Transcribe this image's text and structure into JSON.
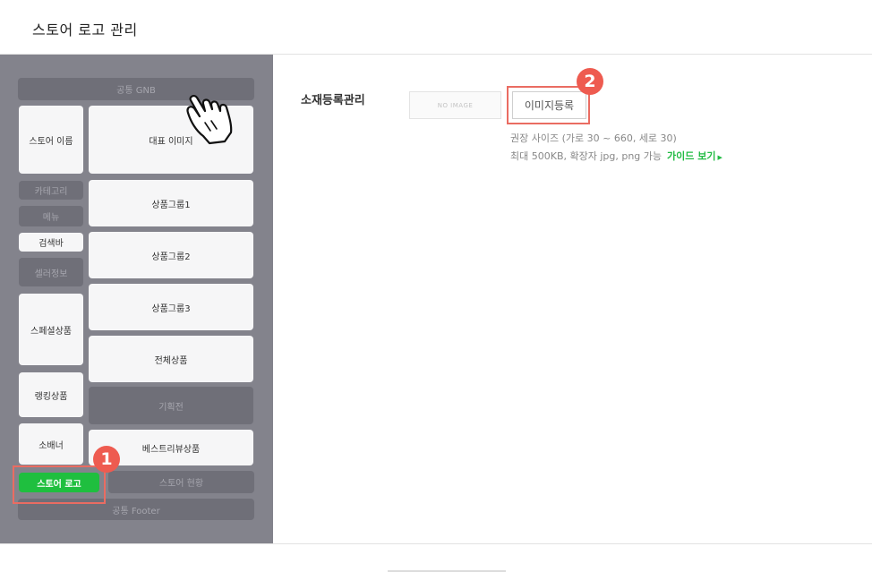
{
  "header": {
    "title": "스토어 로고 관리"
  },
  "layout_panel": {
    "gnb": "공통 GNB",
    "store_name": "스토어 이름",
    "main_image": "대표 이미지",
    "category": "카테고리",
    "menu": "메뉴",
    "search_bar": "검색바",
    "seller_info": "셀러정보",
    "special_products": "스페셜상품",
    "ranking_products": "랭킹상품",
    "small_banner": "소배너",
    "store_logo": "스토어 로고",
    "product_group_1": "상품그룹1",
    "product_group_2": "상품그룹2",
    "product_group_3": "상품그룹3",
    "all_products": "전체상품",
    "exhibition": "기획전",
    "best_review": "베스트리뷰상품",
    "store_status": "스토어 현황",
    "footer": "공통 Footer"
  },
  "badges": {
    "one": "1",
    "two": "2"
  },
  "material": {
    "label": "소재등록관리",
    "no_image": "NO IMAGE",
    "register_button": "이미지등록",
    "size_hint": "권장 사이즈 (가로 30 ~ 660, 세로 30)",
    "format_hint": "최대 500KB, 확장자 jpg, png 가능",
    "guide_link": "가이드 보기",
    "guide_arrow": "▶"
  },
  "colors": {
    "accent_green": "#1fbf3f",
    "badge_red": "#ee5b50",
    "panel_gray": "#83838c"
  },
  "icons": {
    "pointer": "hand-pointer-icon"
  }
}
